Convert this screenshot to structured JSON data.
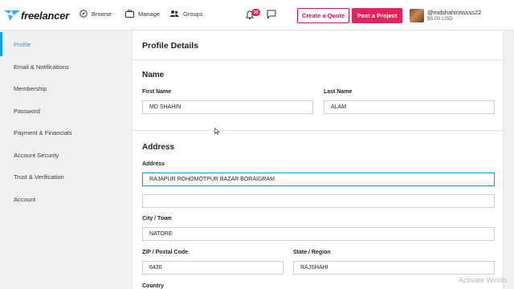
{
  "brand": {
    "name": "freelancer"
  },
  "nav": {
    "browse": "Browse",
    "manage": "Manage",
    "groups": "Groups",
    "notification_count": "30",
    "create_quote": "Create a Quote",
    "post_project": "Post a Project",
    "username": "@mdshahinsssss22",
    "balance": "$5.00 USD"
  },
  "sidebar": {
    "items": [
      {
        "label": "Profile",
        "active": true
      },
      {
        "label": "Email & Notifications"
      },
      {
        "label": "Membership"
      },
      {
        "label": "Password"
      },
      {
        "label": "Payment & Financials"
      },
      {
        "label": "Account Security"
      },
      {
        "label": "Trust & Verification"
      },
      {
        "label": "Account"
      }
    ]
  },
  "main": {
    "title": "Profile Details",
    "name_section": {
      "heading": "Name",
      "first_name_label": "First Name",
      "first_name_value": "MD SHAHIN",
      "last_name_label": "Last Name",
      "last_name_value": "ALAM"
    },
    "address_section": {
      "heading": "Address",
      "address_label": "Address",
      "address_line1": "RAJAPUR ROHOMOTPUR BAZAR BORAIGRAM",
      "address_line2": "",
      "city_label": "City / Town",
      "city_value": "NATORE",
      "zip_label": "ZIP / Postal Code",
      "zip_value": "6430",
      "state_label": "State / Region",
      "state_value": "RAJSHAHI",
      "country_label": "Country"
    }
  },
  "watermark": "Activate Windo",
  "colors": {
    "accent": "#139ff0",
    "brand_pink": "#e0245e"
  }
}
